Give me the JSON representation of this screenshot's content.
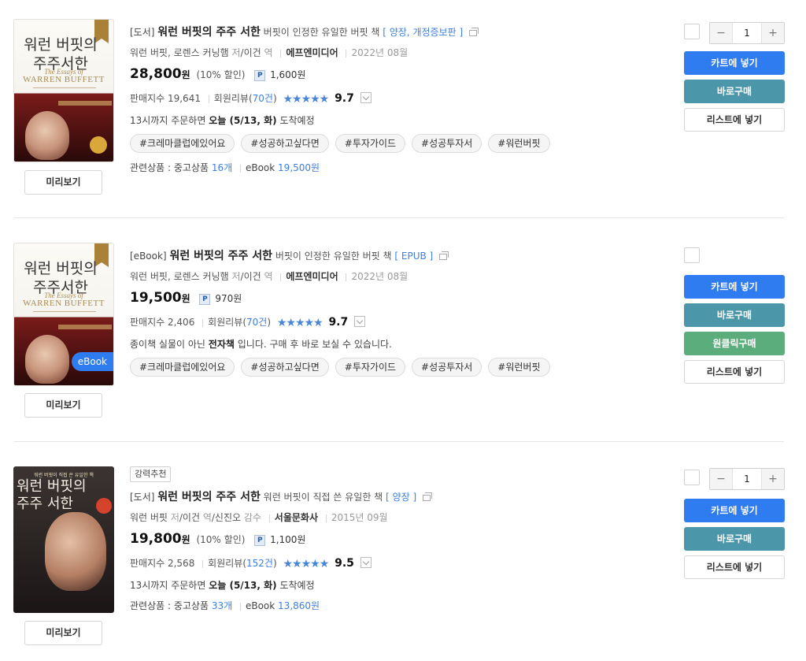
{
  "items": [
    {
      "cover": {
        "title_lines": "워런 버핏의\n주주서한",
        "subtitle": "The Essays of",
        "author_en": "WARREN BUFFETT"
      },
      "preview_label": "미리보기",
      "category": "[도서]",
      "title": "워런 버핏의 주주 서한",
      "subtitle": "버핏이 인정한 유일한 버핏 책",
      "edition": "[ 양장, 개정증보판 ]",
      "authors": "워런 버핏, 로렌스 커닝햄",
      "author_role": "저",
      "translator": "/이건",
      "translator_role": "역",
      "publisher": "에프엔미디어",
      "date": "2022년 08월",
      "price": "28,800",
      "currency": "원",
      "discount": "(10% 할인)",
      "points_badge": "P",
      "points": "1,600원",
      "sales_label": "판매지수 19,641",
      "review_prefix": "회원리뷰(",
      "review_count": "70건",
      "review_suffix": ")",
      "stars": "★★★★★",
      "score": "9.7",
      "delivery_prefix": "13시까지 주문하면",
      "delivery_date": "오늘 (5/13, 화)",
      "delivery_suffix": "도착예정",
      "tags": [
        "#크레마클럽에있어요",
        "#성공하고싶다면",
        "#투자가이드",
        "#성공투자서",
        "#워런버핏"
      ],
      "related_label": "관련상품 : 중고상품",
      "used_count": "16개",
      "ebook_label": "eBook",
      "ebook_price": "19,500원",
      "quantity": "1",
      "qty_minus": "−",
      "qty_plus": "+",
      "cart_label": "카트에 넣기",
      "buy_label": "바로구매",
      "list_label": "리스트에 넣기"
    },
    {
      "cover": {
        "title_lines": "워런 버핏의\n주주서한",
        "subtitle": "The Essays of",
        "author_en": "WARREN BUFFETT",
        "ebook_tag": "eBook"
      },
      "preview_label": "미리보기",
      "category": "[eBook]",
      "title": "워런 버핏의 주주 서한",
      "subtitle": "버핏이 인정한 유일한 버핏 책",
      "edition": "[ EPUB ]",
      "authors": "워런 버핏, 로렌스 커닝햄",
      "author_role": "저",
      "translator": "/이건",
      "translator_role": "역",
      "publisher": "에프엔미디어",
      "date": "2022년 08월",
      "price": "19,500",
      "currency": "원",
      "points_badge": "P",
      "points": "970원",
      "sales_label": "판매지수 2,406",
      "review_prefix": "회원리뷰(",
      "review_count": "70건",
      "review_suffix": ")",
      "stars": "★★★★★",
      "score": "9.7",
      "notice_prefix": "종이책 실물이 아닌",
      "notice_bold": "전자책",
      "notice_suffix": "입니다. 구매 후 바로 보실 수 있습니다.",
      "tags": [
        "#크레마클럽에있어요",
        "#성공하고싶다면",
        "#투자가이드",
        "#성공투자서",
        "#워런버핏"
      ],
      "cart_label": "카트에 넣기",
      "buy_label": "바로구매",
      "oneclick_label": "원클릭구매",
      "list_label": "리스트에 넣기"
    },
    {
      "cover": {
        "top_line": "워런 버핏이 직접 쓴 유일한 책",
        "title_lines": "워런 버핏의\n주주 서한"
      },
      "preview_label": "미리보기",
      "badge": "강력추천",
      "category": "[도서]",
      "title": "워런 버핏의 주주 서한",
      "subtitle": "워런 버핏이 직접 쓴 유일한 책",
      "edition": "[ 양장 ]",
      "authors": "워런 버핏",
      "author_role": "저",
      "translator": "/이건",
      "translator_role": "역",
      "translator2": "/신진오",
      "translator2_role": "감수",
      "publisher": "서울문화사",
      "date": "2015년 09월",
      "price": "19,800",
      "currency": "원",
      "discount": "(10% 할인)",
      "points_badge": "P",
      "points": "1,100원",
      "sales_label": "판매지수 2,568",
      "review_prefix": "회원리뷰(",
      "review_count": "152건",
      "review_suffix": ")",
      "stars": "★★★★★",
      "score": "9.5",
      "delivery_prefix": "13시까지 주문하면",
      "delivery_date": "오늘 (5/13, 화)",
      "delivery_suffix": "도착예정",
      "related_label": "관련상품 : 중고상품",
      "used_count": "33개",
      "ebook_label": "eBook",
      "ebook_price": "13,860원",
      "quantity": "1",
      "qty_minus": "−",
      "qty_plus": "+",
      "cart_label": "카트에 넣기",
      "buy_label": "바로구매",
      "list_label": "리스트에 넣기"
    }
  ],
  "colors": {
    "cart": "#2f7cf0",
    "buy": "#4b97a9",
    "oneclick": "#5cad7c",
    "link": "#3d7fe0",
    "stars": "#4a86d6"
  },
  "icons": [
    "external-link-icon",
    "dropdown-arrow-icon",
    "points-badge-icon",
    "star-icon"
  ]
}
